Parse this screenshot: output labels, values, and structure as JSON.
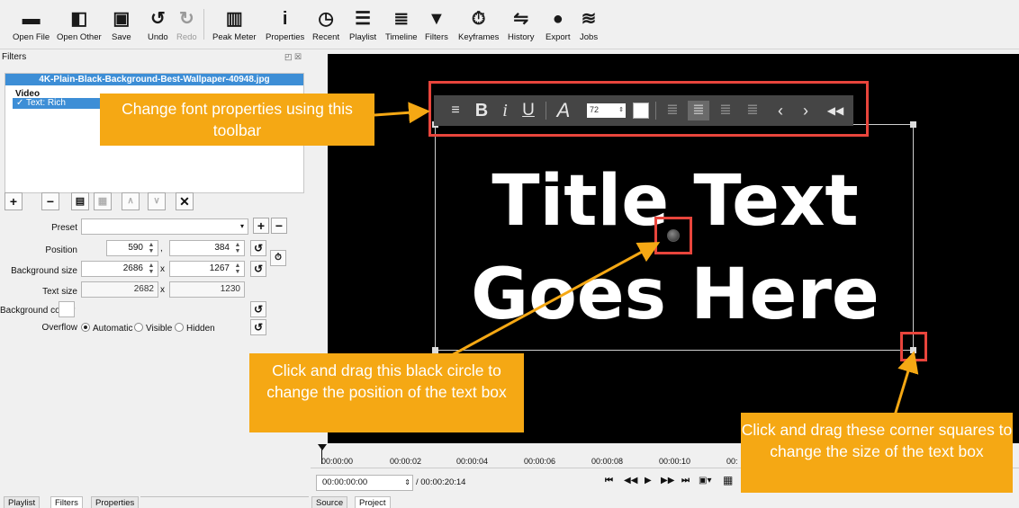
{
  "toolbar": {
    "open_file": "Open File",
    "open_other": "Open Other",
    "save": "Save",
    "undo": "Undo",
    "redo": "Redo",
    "peak_meter": "Peak Meter",
    "properties": "Properties",
    "recent": "Recent",
    "playlist": "Playlist",
    "timeline": "Timeline",
    "filters": "Filters",
    "keyframes": "Keyframes",
    "history": "History",
    "export": "Export",
    "jobs": "Jobs"
  },
  "filters_panel": {
    "title": "Filters",
    "file_name": "4K-Plain-Black-Background-Best-Wallpaper-40948.jpg",
    "video_label": "Video",
    "filter_item": "Text: Rich",
    "preset_label": "Preset",
    "position_label": "Position",
    "position_x": "590",
    "position_y": "384",
    "bg_size_label": "Background size",
    "bg_w": "2686",
    "bg_h": "1267",
    "x_sep": "x",
    "comma": ",",
    "text_size_label": "Text size",
    "text_w": "2682",
    "text_h": "1230",
    "bg_colour_label": "Background colour",
    "overflow_label": "Overflow",
    "overflow_options": [
      "Automatic",
      "Visible",
      "Hidden"
    ],
    "overflow_selected": "Automatic"
  },
  "viewer": {
    "title_line1": "Title Text",
    "title_line2": "Goes Here",
    "font_size": "72"
  },
  "timeline": {
    "ticks": [
      "00:00:00",
      "00:00:02",
      "00:00:04",
      "00:00:06",
      "00:00:08",
      "00:00:10",
      "00:"
    ],
    "current_time": "00:00:00:00",
    "total_time": "/ 00:00:20:14"
  },
  "tabs": {
    "playlist": "Playlist",
    "filters": "Filters",
    "properties": "Properties",
    "source": "Source",
    "project": "Project"
  },
  "callouts": {
    "toolbar_tip": "Change font properties using this toolbar",
    "circle_tip": "Click and drag this black circle to change the position of the text box",
    "corner_tip": "Click and drag these corner squares to change the size of the text box"
  },
  "colors": {
    "callout": "#f5a814",
    "highlight_box": "#e8453c",
    "selection": "#3d8ed6"
  }
}
